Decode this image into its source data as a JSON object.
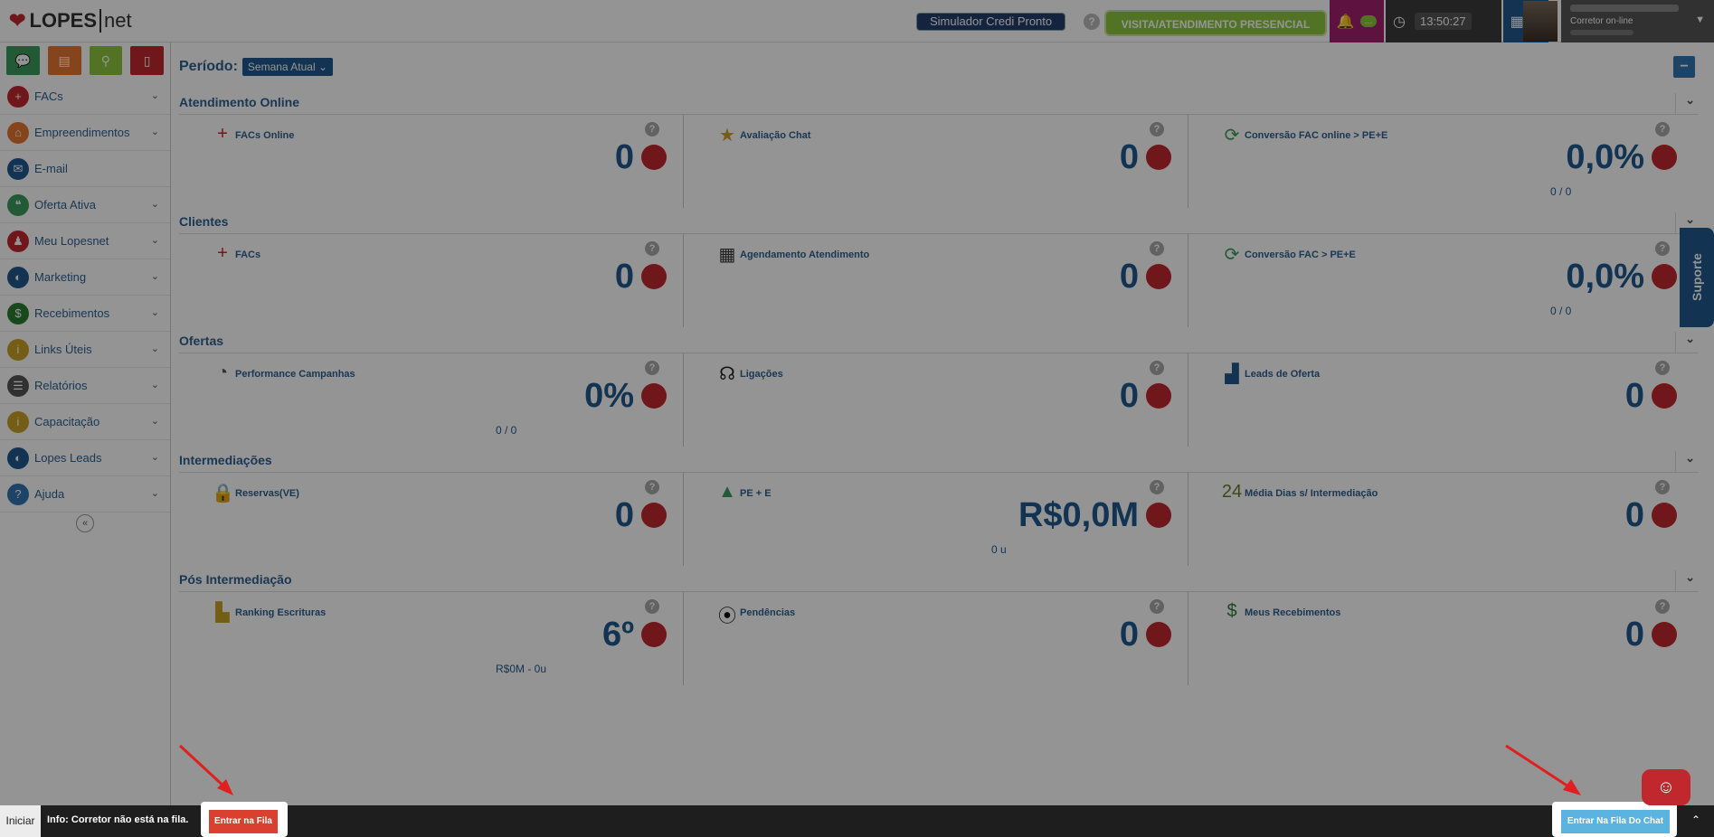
{
  "brand": {
    "name": "LOPES",
    "suffix": "net"
  },
  "topbar": {
    "simulator_label": "Simulador Credi Pronto",
    "help": "?",
    "visita_label": "VISITA/ATENDIMENTO PRESENCIAL",
    "notif_count": "...",
    "time": "13:50:27",
    "calendar_count": "0",
    "user_status": "Corretor on-line"
  },
  "quick_actions": [
    {
      "icon": "chat-icon",
      "color": "#3a9b5a"
    },
    {
      "icon": "building-icon",
      "color": "#e5762f"
    },
    {
      "icon": "search-icon",
      "color": "#8dc63f"
    },
    {
      "icon": "document-icon",
      "color": "#c0282d"
    }
  ],
  "sidebar": {
    "items": [
      {
        "label": "FACs",
        "icon": "facs-icon",
        "color": "#c0282d"
      },
      {
        "label": "Empreendimentos",
        "icon": "house-icon",
        "color": "#e5762f"
      },
      {
        "label": "E-mail",
        "icon": "email-icon",
        "color": "#1f5a8e"
      },
      {
        "label": "Oferta Ativa",
        "icon": "chat-bubbles-icon",
        "color": "#3a9b5a"
      },
      {
        "label": "Meu Lopesnet",
        "icon": "user-icon",
        "color": "#c0282d"
      },
      {
        "label": "Marketing",
        "icon": "megaphone-icon",
        "color": "#1f5a8e"
      },
      {
        "label": "Recebimentos",
        "icon": "money-bag-icon",
        "color": "#2e7d32"
      },
      {
        "label": "Links Úteis",
        "icon": "info-icon",
        "color": "#c9a227"
      },
      {
        "label": "Relatórios",
        "icon": "report-icon",
        "color": "#555555"
      },
      {
        "label": "Capacitação",
        "icon": "info-icon",
        "color": "#c9a227"
      },
      {
        "label": "Lopes Leads",
        "icon": "megaphone-icon",
        "color": "#1f5a8e"
      },
      {
        "label": "Ajuda",
        "icon": "help-icon",
        "color": "#3276b1"
      }
    ]
  },
  "main": {
    "periodo_label": "Período:",
    "periodo_value": "Semana Atual",
    "sections": [
      {
        "title": "Atendimento Online",
        "cards": [
          {
            "title": "FACs Online",
            "value": "0",
            "sub": "",
            "icon": "facs-icon"
          },
          {
            "title": "Avaliação Chat",
            "value": "0",
            "sub": "",
            "icon": "star-icon"
          },
          {
            "title": "Conversão FAC online > PE+E",
            "value": "0,0%",
            "sub": "0 / 0",
            "icon": "refresh-icon"
          }
        ]
      },
      {
        "title": "Clientes",
        "cards": [
          {
            "title": "FACs",
            "value": "0",
            "sub": "",
            "icon": "facs-icon"
          },
          {
            "title": "Agendamento Atendimento",
            "value": "0",
            "sub": "",
            "icon": "calendar-icon"
          },
          {
            "title": "Conversão FAC > PE+E",
            "value": "0,0%",
            "sub": "0 / 0",
            "icon": "refresh-icon"
          }
        ]
      },
      {
        "title": "Ofertas",
        "cards": [
          {
            "title": "Performance Campanhas",
            "value": "0%",
            "sub": "0 / 0",
            "icon": "gauge-icon"
          },
          {
            "title": "Ligações",
            "value": "0",
            "sub": "",
            "icon": "headset-icon"
          },
          {
            "title": "Leads de Oferta",
            "value": "0",
            "sub": "",
            "icon": "bar-chart-icon"
          }
        ]
      },
      {
        "title": "Intermediações",
        "cards": [
          {
            "title": "Reservas(VE)",
            "value": "0",
            "sub": "",
            "icon": "lock-icon"
          },
          {
            "title": "PE + E",
            "value": "R$0,0M",
            "sub": "0 u",
            "icon": "growth-chart-icon"
          },
          {
            "title": "Média Dias s/ Intermediação",
            "value": "0",
            "sub": "",
            "icon": "calendar-24-icon"
          }
        ]
      },
      {
        "title": "Pós Intermediação",
        "cards": [
          {
            "title": "Ranking Escrituras",
            "value": "6º",
            "sub": "R$0M - 0u",
            "icon": "podium-icon"
          },
          {
            "title": "Pendências",
            "value": "0",
            "sub": "",
            "icon": "traffic-light-icon"
          },
          {
            "title": "Meus Recebimentos",
            "value": "0",
            "sub": "",
            "icon": "money-bag-icon"
          }
        ]
      }
    ]
  },
  "suporte_label": "Suporte",
  "bottom": {
    "iniciar_label": "Iniciar",
    "info_text": "Info:  Corretor não está na fila.",
    "fila_label": "Entrar na Fila",
    "chat_label": "Entrar Na Fila Do Chat"
  }
}
